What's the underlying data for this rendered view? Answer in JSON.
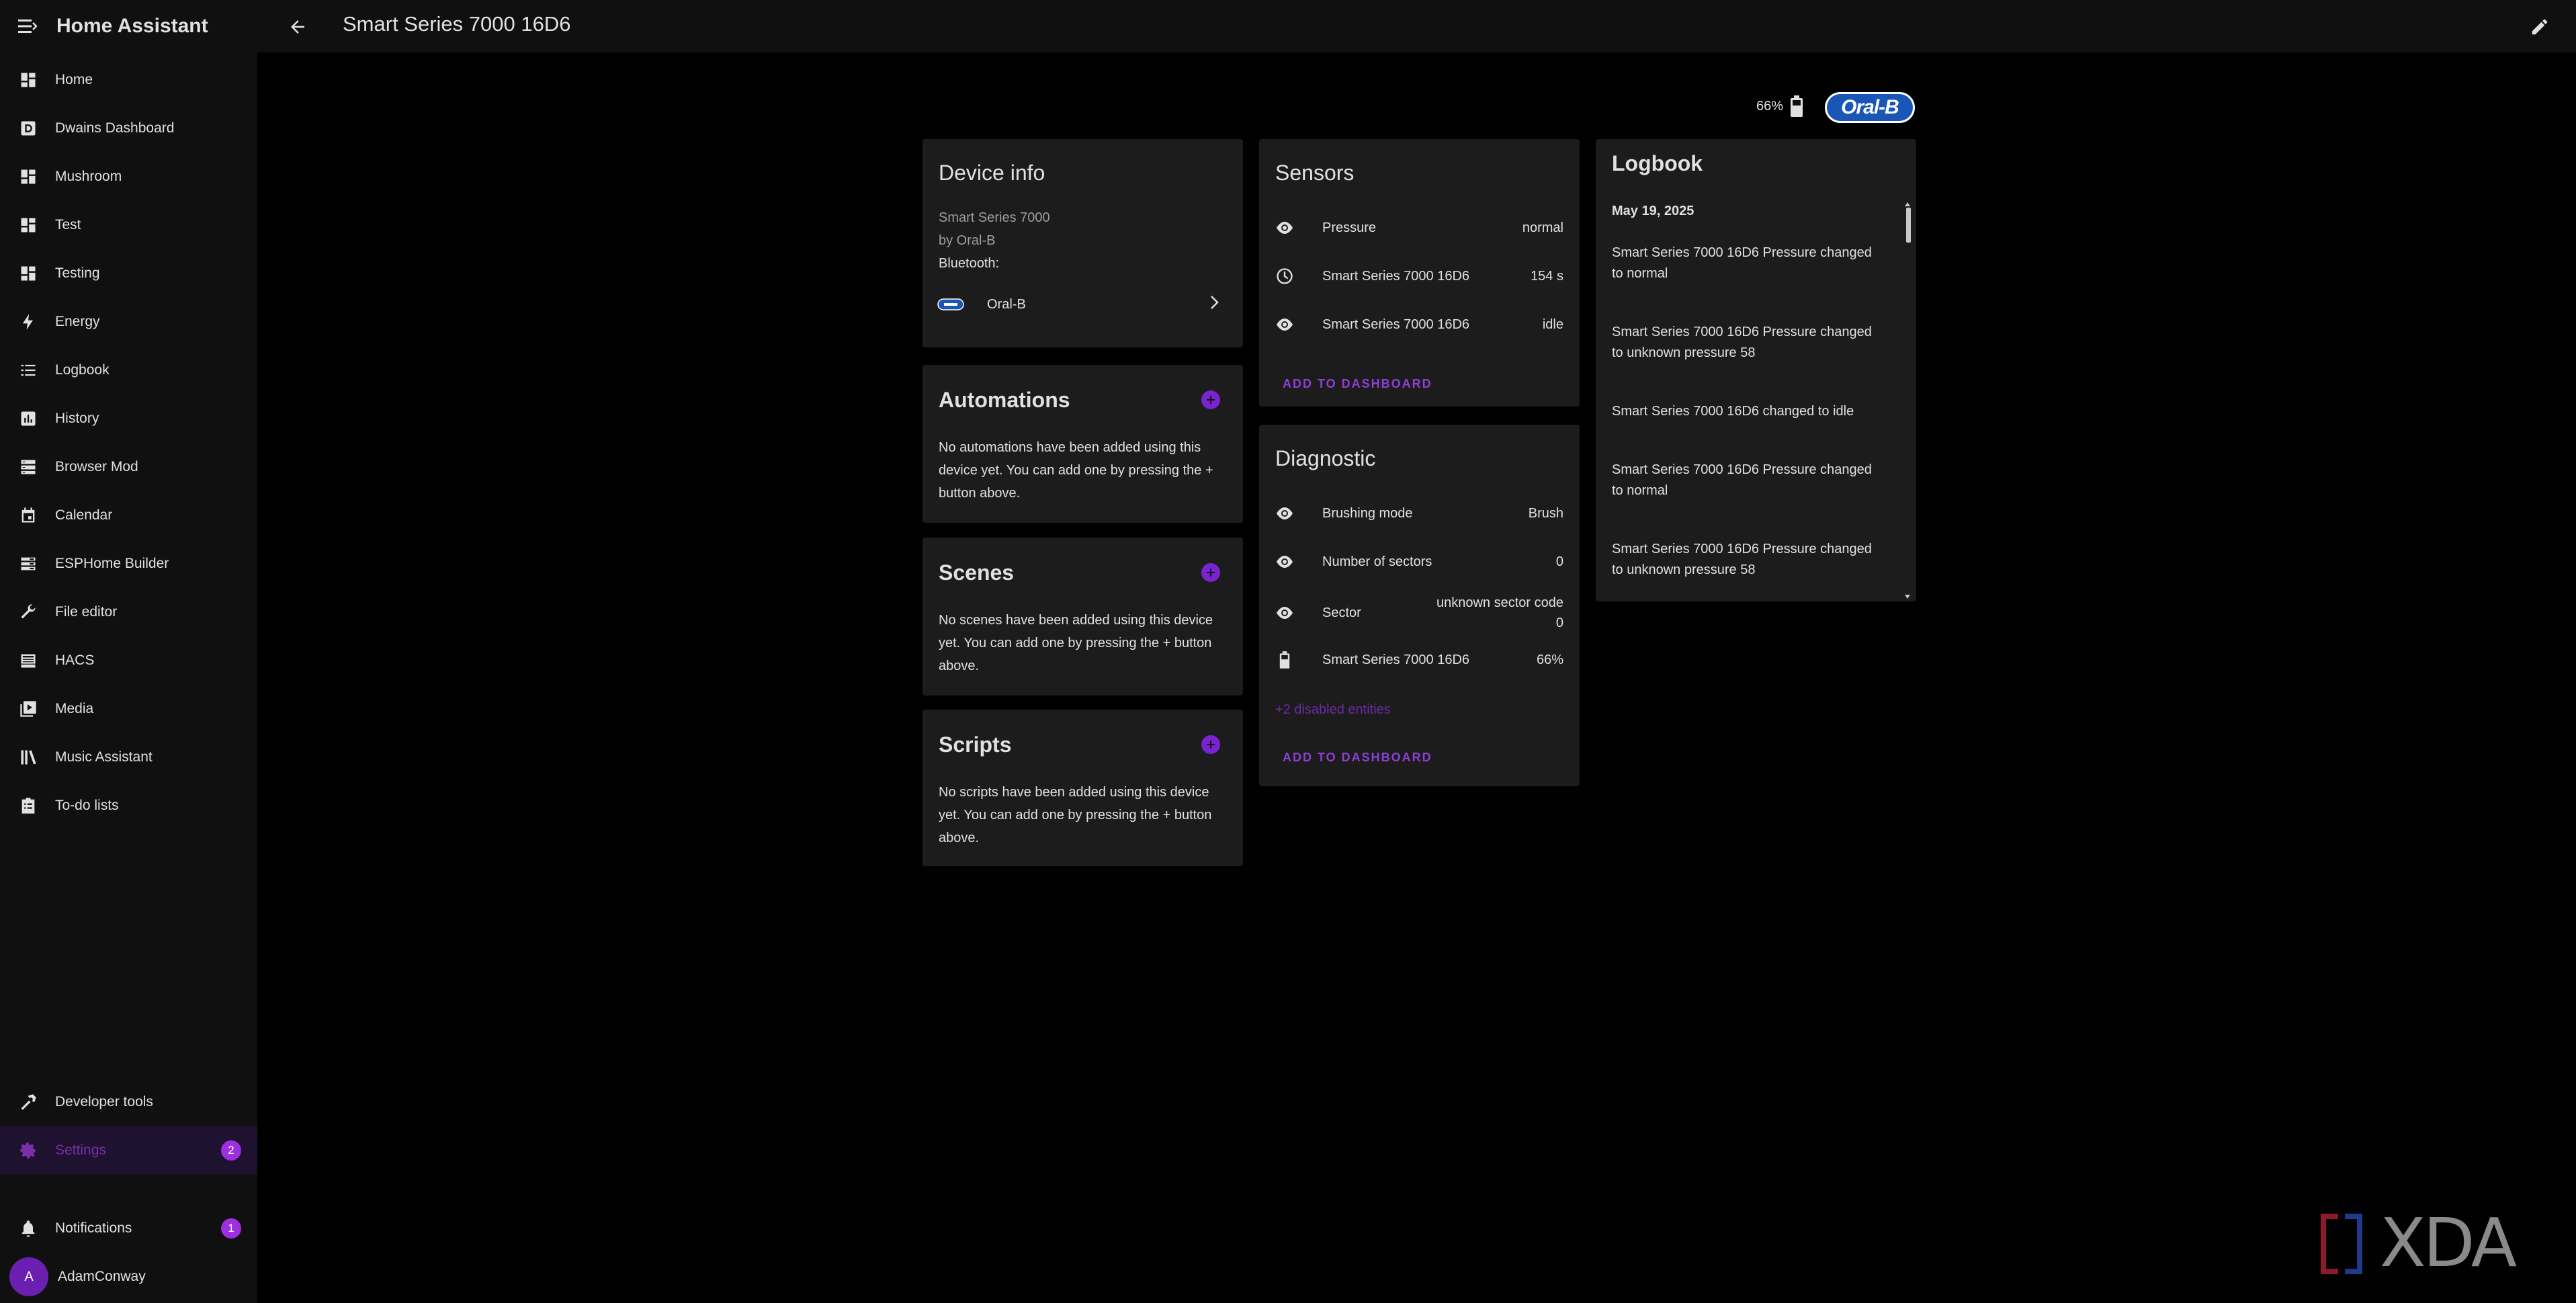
{
  "sidebar": {
    "title": "Home Assistant",
    "items": [
      {
        "label": "Home",
        "icon": "dashboard-icon"
      },
      {
        "label": "Dwains Dashboard",
        "icon": "dashboard-d-icon"
      },
      {
        "label": "Mushroom",
        "icon": "dashboard-icon"
      },
      {
        "label": "Test",
        "icon": "dashboard-icon"
      },
      {
        "label": "Testing",
        "icon": "dashboard-icon"
      },
      {
        "label": "Energy",
        "icon": "lightning-icon"
      },
      {
        "label": "Logbook",
        "icon": "list-icon"
      },
      {
        "label": "History",
        "icon": "chart-icon"
      },
      {
        "label": "Browser Mod",
        "icon": "server-icon"
      },
      {
        "label": "Calendar",
        "icon": "calendar-icon"
      },
      {
        "label": "ESPHome Builder",
        "icon": "chip-icon"
      },
      {
        "label": "File editor",
        "icon": "wrench-icon"
      },
      {
        "label": "HACS",
        "icon": "hacs-icon"
      },
      {
        "label": "Media",
        "icon": "media-icon"
      },
      {
        "label": "Music Assistant",
        "icon": "music-library-icon"
      },
      {
        "label": "To-do lists",
        "icon": "clipboard-icon"
      }
    ],
    "developer_tools": "Developer tools",
    "settings": "Settings",
    "settings_badge": "2",
    "notifications": "Notifications",
    "notifications_badge": "1",
    "user_initial": "A",
    "user_name": "AdamConway"
  },
  "topbar": {
    "title": "Smart Series 7000 16D6"
  },
  "header_status": {
    "battery": "66%",
    "brand": "Oral-B"
  },
  "device_info": {
    "title": "Device info",
    "model": "Smart Series 7000",
    "manufacturer": "by Oral-B",
    "connection": "Bluetooth:",
    "integration": "Oral-B"
  },
  "automations": {
    "title": "Automations",
    "text": "No automations have been added using this device yet. You can add one by pressing the + button above."
  },
  "scenes": {
    "title": "Scenes",
    "text": "No scenes have been added using this device yet. You can add one by pressing the + button above."
  },
  "scripts": {
    "title": "Scripts",
    "text": "No scripts have been added using this device yet. You can add one by pressing the + button above."
  },
  "sensors": {
    "title": "Sensors",
    "rows": [
      {
        "name": "Pressure",
        "value": "normal",
        "icon": "eye-icon"
      },
      {
        "name": "Smart Series 7000 16D6",
        "value": "154 s",
        "icon": "timer-icon"
      },
      {
        "name": "Smart Series 7000 16D6",
        "value": "idle",
        "icon": "eye-icon"
      }
    ],
    "add_label": "ADD TO DASHBOARD"
  },
  "diagnostic": {
    "title": "Diagnostic",
    "rows": [
      {
        "name": "Brushing mode",
        "value": "Brush",
        "icon": "eye-icon"
      },
      {
        "name": "Number of sectors",
        "value": "0",
        "icon": "eye-icon"
      },
      {
        "name": "Sector",
        "value_line1": "unknown sector code",
        "value_line2": "0",
        "icon": "eye-icon"
      },
      {
        "name": "Smart Series 7000 16D6",
        "value": "66%",
        "icon": "battery-icon"
      }
    ],
    "disabled_link": "+2 disabled entities",
    "add_label": "ADD TO DASHBOARD"
  },
  "logbook": {
    "title": "Logbook",
    "date": "May 19, 2025",
    "entries": [
      {
        "line1": "Smart Series 7000 16D6 Pressure changed",
        "line2": "to normal"
      },
      {
        "line1": "Smart Series 7000 16D6 Pressure changed",
        "line2": "to unknown pressure 58"
      },
      {
        "line1": "Smart Series 7000 16D6 changed to idle",
        "line2": ""
      },
      {
        "line1": "Smart Series 7000 16D6 Pressure changed",
        "line2": "to normal"
      },
      {
        "line1": "Smart Series 7000 16D6 Pressure changed",
        "line2": "to unknown pressure 58"
      }
    ]
  },
  "watermark": "XDA",
  "colors": {
    "accent": "#8e3fd6",
    "sidebar_bg": "#101010",
    "card_bg": "#1c1c1c",
    "page_bg": "#000000",
    "badge": "#9c2fe0",
    "brand_blue": "#1a56b6"
  }
}
